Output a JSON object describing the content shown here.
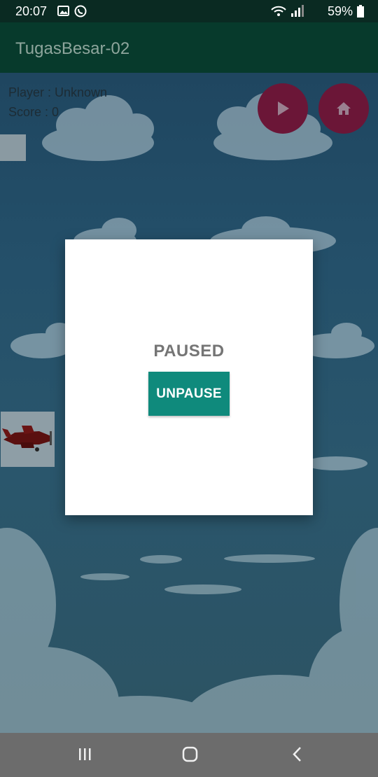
{
  "status_bar": {
    "time": "20:07",
    "battery": "59%",
    "icons": [
      "image-icon",
      "whatsapp-icon",
      "wifi-icon",
      "signal-icon",
      "battery-icon"
    ]
  },
  "app_bar": {
    "title": "TugasBesar-02"
  },
  "game": {
    "player_label": "Player : Unknown",
    "score_label": "Score : 0",
    "play_button_icon": "play-icon",
    "home_button_icon": "home-icon",
    "colors": {
      "sky": "#24506a",
      "button": "#6b1637"
    }
  },
  "dialog": {
    "title": "PAUSED",
    "button_label": "UNPAUSE",
    "button_color": "#0f8a7c"
  },
  "nav_bar": {
    "icons": [
      "recents-icon",
      "home-nav-icon",
      "back-icon"
    ]
  }
}
